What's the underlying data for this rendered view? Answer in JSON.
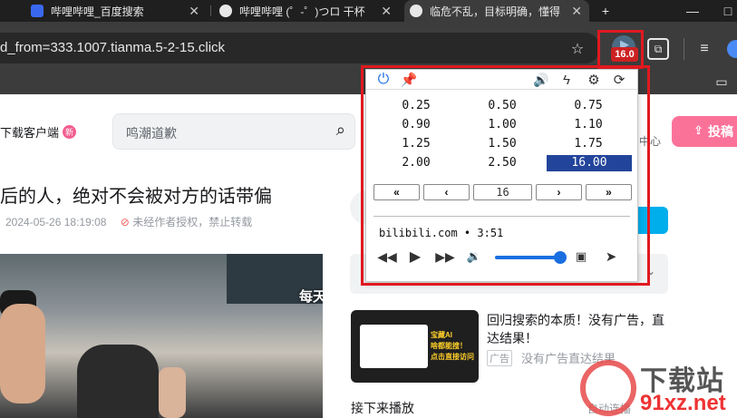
{
  "tabs": [
    {
      "label": "哔哩哔哩_百度搜索",
      "active": false
    },
    {
      "label": "哔哩哔哩 (゜-゜)つロ 干杯",
      "active": false
    },
    {
      "label": "临危不乱，目标明确，懂得",
      "active": true
    }
  ],
  "new_tab_label": "+",
  "window_controls": {
    "minimize": "—",
    "maximize": "□"
  },
  "address_bar": {
    "url": "d_from=333.1007.tianma.5-2-15.click"
  },
  "extension_badge": "16.0",
  "page": {
    "download_client": "下载客户端",
    "new_badge": "新",
    "search_placeholder": "鸣潮道歉",
    "center_label": "中心",
    "upload_label": "投稿",
    "video_title": "后的人，绝对不会被对方的话带偏",
    "video_date": "2024-05-26 18:19:08",
    "copyright_note": "未经作者授权，禁止转载",
    "video_caption": "每天",
    "ad_title": "回归搜索的本质！没有广告，直达结果！",
    "ad_badge": "广告",
    "ad_subtitle": "没有广告直达结果",
    "ad_image_lines": [
      "宝藏AI",
      "啥都能搜！",
      "点击直接访问"
    ],
    "next_play": "接下来播放",
    "autoplay": "自动连播"
  },
  "watermark": {
    "brand": "下载站",
    "url": "91xz.net"
  },
  "popup": {
    "rates": [
      [
        "0.25",
        "0.50",
        "0.75"
      ],
      [
        "0.90",
        "1.00",
        "1.10"
      ],
      [
        "1.25",
        "1.50",
        "1.75"
      ],
      [
        "2.00",
        "2.50",
        "16.00"
      ]
    ],
    "selected_rate": "16.00",
    "nav": {
      "first": "«",
      "prev": "‹",
      "value": "16",
      "next": "›",
      "last": "»"
    },
    "site_info": "bilibili.com • 3:51",
    "volume": 0.95
  },
  "colors": {
    "accent_blue": "#1a6fe0",
    "selected_rate_bg": "#23449b",
    "highlight_red": "#e0191f",
    "bilibili_pink": "#fb7299"
  }
}
